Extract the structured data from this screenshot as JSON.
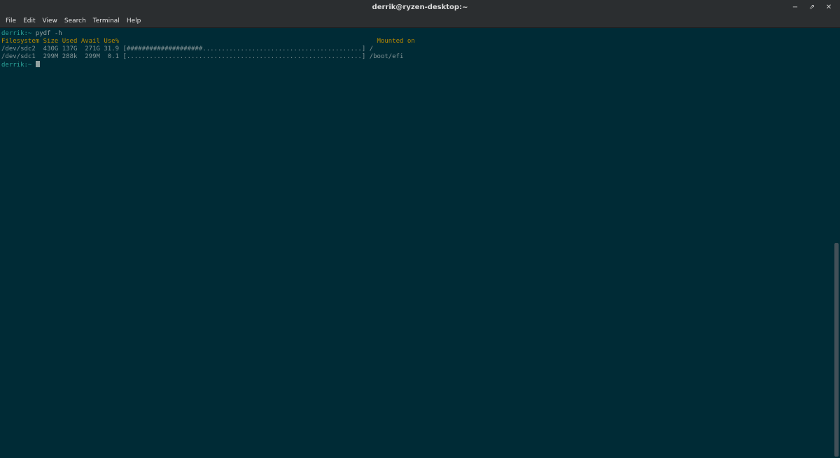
{
  "window": {
    "title": "derrik@ryzen-desktop:~",
    "buttons": {
      "minimize": "−",
      "maximize": "⇗",
      "close": "✕"
    }
  },
  "menubar": {
    "items": [
      "File",
      "Edit",
      "View",
      "Search",
      "Terminal",
      "Help"
    ]
  },
  "terminal": {
    "prompt": "derrik:~ ",
    "command": "pydf -h",
    "header": {
      "filesystem": "Filesystem",
      "size": "Size",
      "used": "Used",
      "avail": "Avail",
      "use_pct": "Use%",
      "mounted_on": "Mounted on"
    },
    "rows": [
      {
        "filesystem": "/dev/sdc2",
        "size": "430G",
        "used": "137G",
        "avail": "271G",
        "use_pct": "31.9",
        "bar": "[####################..........................................]",
        "mounted_on": "/"
      },
      {
        "filesystem": "/dev/sdc1",
        "size": "299M",
        "used": "288k",
        "avail": "299M",
        "use_pct": "0.1",
        "bar": "[..............................................................]",
        "mounted_on": "/boot/efi"
      }
    ],
    "final_prompt": "derrik:~ "
  },
  "colors": {
    "background": "#002b36",
    "prompt": "#2aa198",
    "header": "#b58900",
    "text": "#839496"
  }
}
